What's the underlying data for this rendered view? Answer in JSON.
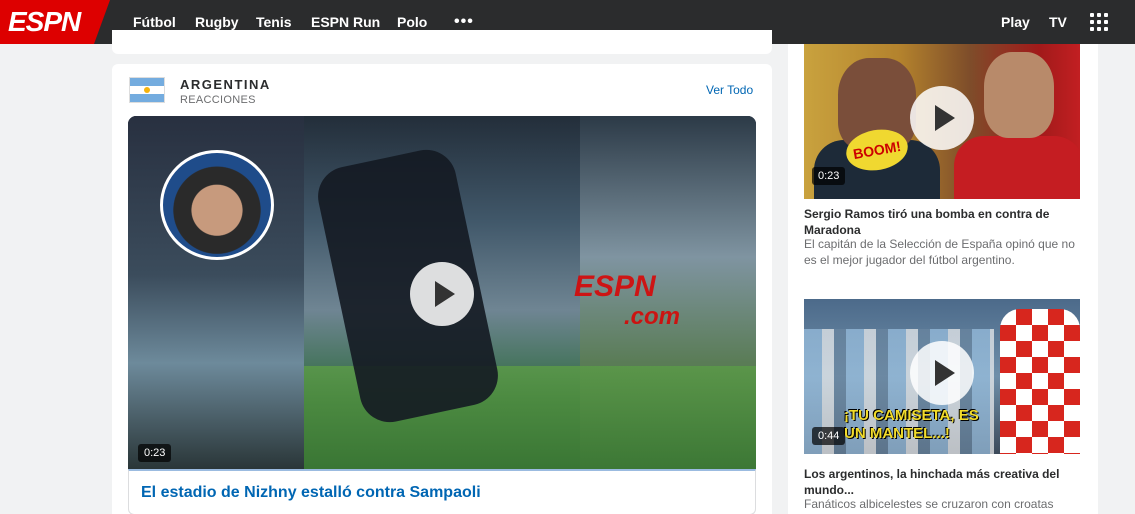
{
  "nav": {
    "logo": "ESPN",
    "items": [
      "Fútbol",
      "Rugby",
      "Tenis",
      "ESPN Run",
      "Polo"
    ],
    "more": "•••",
    "right": [
      "Play",
      "TV"
    ]
  },
  "section": {
    "title": "ARGENTINA",
    "subtitle": "REACCIONES",
    "link": "Ver Todo"
  },
  "main_video": {
    "duration": "0:23",
    "watermark": "ESPN",
    "watermark_sub": ".com",
    "title": "El estadio de Nizhny estalló contra Sampaoli"
  },
  "side_videos": [
    {
      "duration": "0:23",
      "overlay": "BOOM!",
      "title": "Sergio Ramos tiró una bomba en contra de Maradona",
      "description": "El capitán de la Selección de España opinó que no es el mejor jugador del fútbol argentino."
    },
    {
      "duration": "0:44",
      "overlay": "¡TU CAMISETA, ES UN MANTEL...!",
      "title": "Los argentinos, la hinchada más creativa del mundo...",
      "description": "Fanáticos albicelestes se cruzaron con croatas"
    }
  ],
  "colors": {
    "brand": "#dd0000",
    "nav_bg": "#2b2c2d",
    "link": "#0066b3",
    "page_bg": "#f1f2f3"
  }
}
